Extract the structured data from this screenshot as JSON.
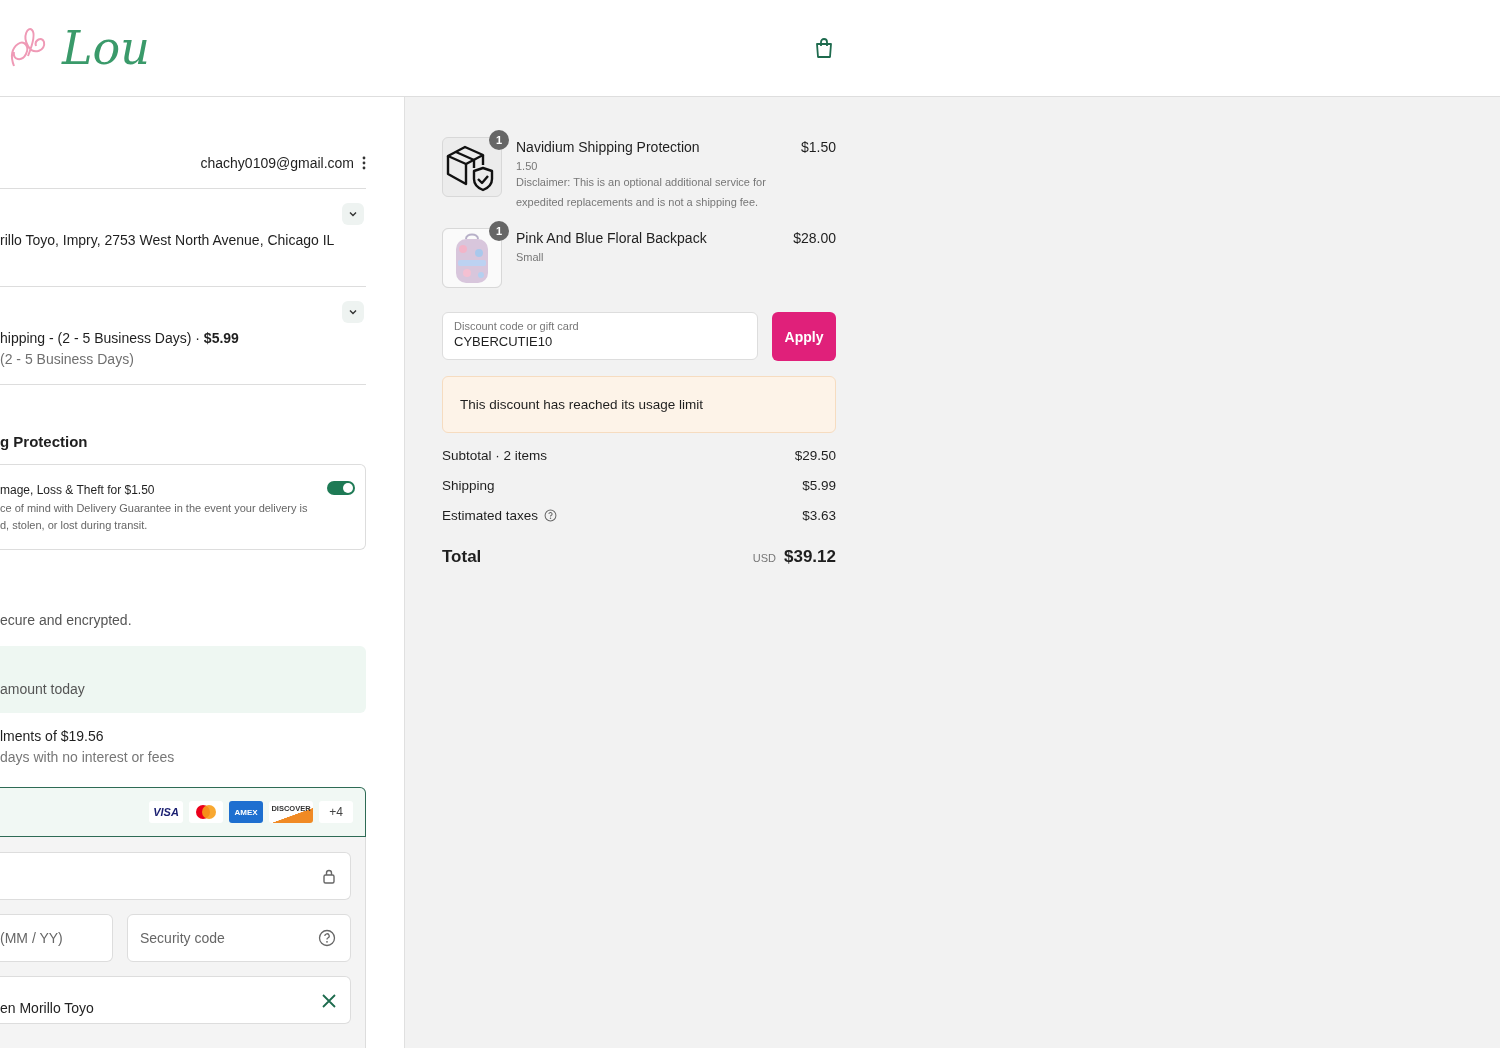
{
  "header": {
    "logo_text": "Lou"
  },
  "contact": {
    "email": "chachy0109@gmail.com"
  },
  "ship_to": {
    "address": "rillo Toyo, Impry, 2753 West North Avenue, Chicago IL"
  },
  "shipping_method": {
    "title": "hipping - (2 - 5 Business Days) · **$5.99**",
    "detail": "(2 - 5 Business Days)"
  },
  "protection": {
    "heading": "g Protection",
    "title": "mage, Loss & Theft for $1.50",
    "description": [
      "ce of mind with Delivery Guarantee in the event your delivery is",
      "d, stolen, or lost during transit."
    ],
    "on": true
  },
  "payment": {
    "note": "ecure and encrypted.",
    "pay_in_full": "amount today",
    "installments_title": "lments of $19.56",
    "installments_detail": "days with no interest or fees",
    "card_brands": [
      {
        "kind": "visa",
        "label": "VISA"
      },
      {
        "kind": "mastercard"
      },
      {
        "kind": "amex",
        "label": "AMEX"
      },
      {
        "kind": "discover",
        "label": "DISCOVER"
      },
      {
        "kind": "more",
        "label": "+4"
      }
    ],
    "expiry_placeholder": "(MM / YY)",
    "security_placeholder": "Security code",
    "name_value": "en Morillo Toyo"
  },
  "summary": {
    "items": [
      {
        "kind": "protection",
        "name": "Navidium Shipping Protection",
        "quantity": "1",
        "variant": "1.50",
        "note": "Disclaimer: This is an optional additional service for expedited replacements and is not a shipping fee.",
        "price": "$1.50"
      },
      {
        "kind": "picture",
        "name": "Pink And Blue Floral Backpack",
        "quantity": "1",
        "variant": "Small",
        "price": "$28.00"
      }
    ],
    "discount": {
      "placeholder": "Discount code or gift card",
      "value": "CYBERCUTIE10",
      "button": "Apply"
    },
    "alert": "This discount has reached its usage limit",
    "lines": [
      {
        "label": "Subtotal · 2 items",
        "value": "$29.50",
        "info": false
      },
      {
        "label": "Shipping",
        "value": "$5.99",
        "info": false
      },
      {
        "label": "Estimated taxes",
        "value": "$3.63",
        "info": true
      }
    ],
    "total": {
      "label": "Total",
      "currency": "USD",
      "value": "$39.12"
    }
  }
}
